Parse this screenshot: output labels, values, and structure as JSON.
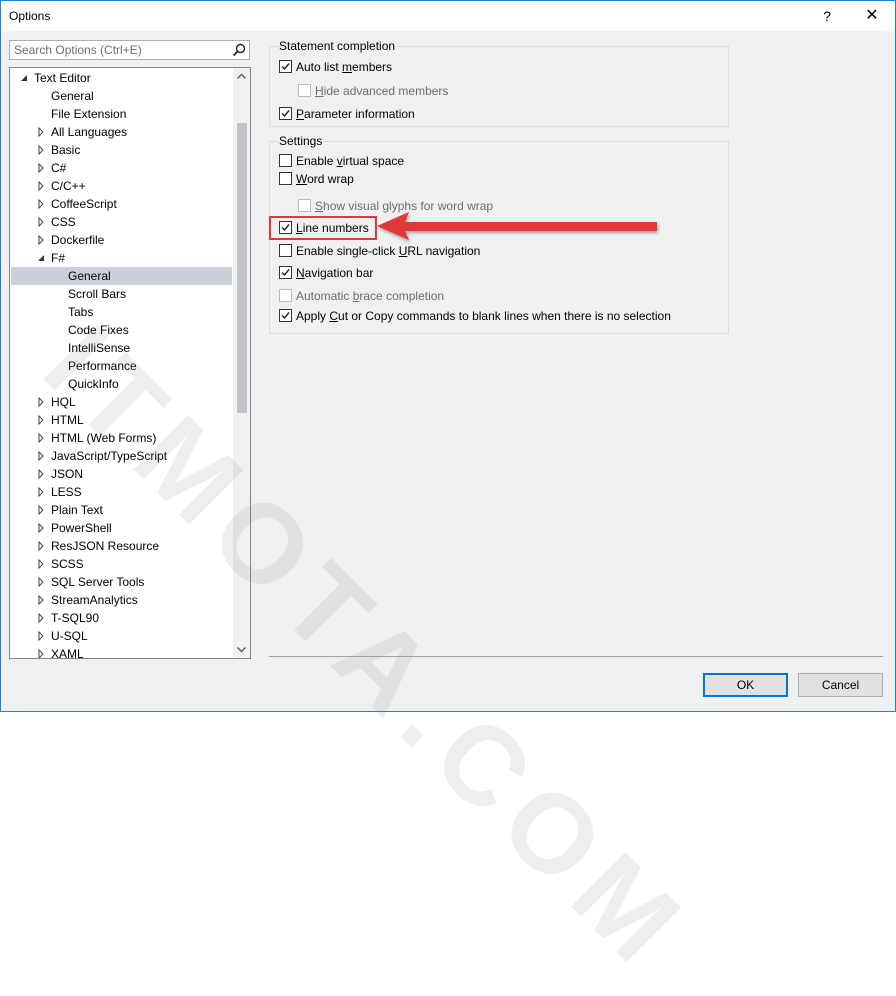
{
  "window": {
    "title": "Options",
    "help": "?",
    "close": "✕"
  },
  "search": {
    "placeholder": "Search Options (Ctrl+E)"
  },
  "tree": [
    {
      "label": "Text Editor",
      "level": 0,
      "arrow": "expanded"
    },
    {
      "label": "General",
      "level": 1,
      "arrow": "none"
    },
    {
      "label": "File Extension",
      "level": 1,
      "arrow": "none"
    },
    {
      "label": "All Languages",
      "level": 1,
      "arrow": "collapsed"
    },
    {
      "label": "Basic",
      "level": 1,
      "arrow": "collapsed"
    },
    {
      "label": "C#",
      "level": 1,
      "arrow": "collapsed"
    },
    {
      "label": "C/C++",
      "level": 1,
      "arrow": "collapsed"
    },
    {
      "label": "CoffeeScript",
      "level": 1,
      "arrow": "collapsed"
    },
    {
      "label": "CSS",
      "level": 1,
      "arrow": "collapsed"
    },
    {
      "label": "Dockerfile",
      "level": 1,
      "arrow": "collapsed"
    },
    {
      "label": "F#",
      "level": 1,
      "arrow": "expanded"
    },
    {
      "label": "General",
      "level": 2,
      "arrow": "none",
      "selected": true
    },
    {
      "label": "Scroll Bars",
      "level": 2,
      "arrow": "none"
    },
    {
      "label": "Tabs",
      "level": 2,
      "arrow": "none"
    },
    {
      "label": "Code Fixes",
      "level": 2,
      "arrow": "none"
    },
    {
      "label": "IntelliSense",
      "level": 2,
      "arrow": "none"
    },
    {
      "label": "Performance",
      "level": 2,
      "arrow": "none"
    },
    {
      "label": "QuickInfo",
      "level": 2,
      "arrow": "none"
    },
    {
      "label": "HQL",
      "level": 1,
      "arrow": "collapsed"
    },
    {
      "label": "HTML",
      "level": 1,
      "arrow": "collapsed"
    },
    {
      "label": "HTML (Web Forms)",
      "level": 1,
      "arrow": "collapsed"
    },
    {
      "label": "JavaScript/TypeScript",
      "level": 1,
      "arrow": "collapsed"
    },
    {
      "label": "JSON",
      "level": 1,
      "arrow": "collapsed"
    },
    {
      "label": "LESS",
      "level": 1,
      "arrow": "collapsed"
    },
    {
      "label": "Plain Text",
      "level": 1,
      "arrow": "collapsed"
    },
    {
      "label": "PowerShell",
      "level": 1,
      "arrow": "collapsed"
    },
    {
      "label": "ResJSON Resource",
      "level": 1,
      "arrow": "collapsed"
    },
    {
      "label": "SCSS",
      "level": 1,
      "arrow": "collapsed"
    },
    {
      "label": "SQL Server Tools",
      "level": 1,
      "arrow": "collapsed"
    },
    {
      "label": "StreamAnalytics",
      "level": 1,
      "arrow": "collapsed"
    },
    {
      "label": "T-SQL90",
      "level": 1,
      "arrow": "collapsed"
    },
    {
      "label": "U-SQL",
      "level": 1,
      "arrow": "collapsed"
    },
    {
      "label": "XAML",
      "level": 1,
      "arrow": "collapsed"
    }
  ],
  "statement_completion": {
    "title": "Statement completion",
    "options": [
      {
        "name": "auto-list-members",
        "pre": "Auto list ",
        "u": "m",
        "post": "embers",
        "checked": true,
        "disabled": false,
        "indent": 0
      },
      {
        "name": "hide-advanced-members",
        "pre": "",
        "u": "H",
        "post": "ide advanced members",
        "checked": false,
        "disabled": true,
        "indent": 1
      },
      {
        "name": "parameter-information",
        "pre": "",
        "u": "P",
        "post": "arameter information",
        "checked": true,
        "disabled": false,
        "indent": 0
      }
    ]
  },
  "settings": {
    "title": "Settings",
    "options": [
      {
        "name": "enable-virtual-space",
        "pre": "Enable ",
        "u": "v",
        "post": "irtual space",
        "checked": false,
        "disabled": false,
        "indent": 0
      },
      {
        "name": "word-wrap",
        "pre": "",
        "u": "W",
        "post": "ord wrap",
        "checked": false,
        "disabled": false,
        "indent": 0
      },
      {
        "name": "show-visual-glyphs",
        "pre": "",
        "u": "S",
        "post": "how visual glyphs for word wrap",
        "checked": false,
        "disabled": true,
        "indent": 1
      },
      {
        "name": "line-numbers",
        "pre": "",
        "u": "L",
        "post": "ine numbers",
        "checked": true,
        "disabled": false,
        "indent": 0
      },
      {
        "name": "single-click-url",
        "pre": "Enable single-click ",
        "u": "U",
        "post": "RL navigation",
        "checked": false,
        "disabled": false,
        "indent": 0
      },
      {
        "name": "navigation-bar",
        "pre": "",
        "u": "N",
        "post": "avigation bar",
        "checked": true,
        "disabled": false,
        "indent": 0
      },
      {
        "name": "automatic-brace-completion",
        "pre": "Automatic ",
        "u": "b",
        "post": "race completion",
        "checked": false,
        "disabled": true,
        "indent": 0
      },
      {
        "name": "apply-cut-copy",
        "pre": "Apply ",
        "u": "C",
        "post": "ut or Copy commands to blank lines when there is no selection",
        "checked": true,
        "disabled": false,
        "indent": 0
      }
    ]
  },
  "buttons": {
    "ok": "OK",
    "cancel": "Cancel"
  },
  "watermark": "ITMOTA.COM",
  "colors": {
    "accent": "#0078d7",
    "highlight": "#e2383b",
    "selection": "#cbcfd9"
  }
}
